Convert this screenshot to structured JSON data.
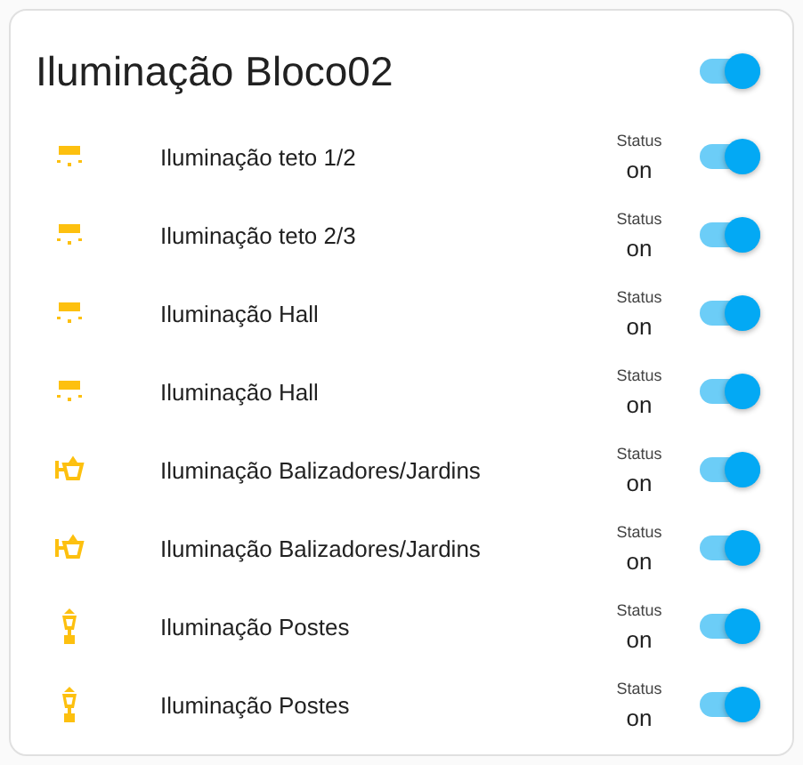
{
  "card": {
    "title": "Iluminação Bloco02",
    "master_on": true
  },
  "entities": [
    {
      "kind": "ceiling",
      "name": "Iluminação teto 1/2",
      "status_label": "Status",
      "status": "on",
      "on": true
    },
    {
      "kind": "ceiling",
      "name": "Iluminação teto 2/3",
      "status_label": "Status",
      "status": "on",
      "on": true
    },
    {
      "kind": "ceiling",
      "name": "Iluminação Hall",
      "status_label": "Status",
      "status": "on",
      "on": true
    },
    {
      "kind": "ceiling",
      "name": "Iluminação Hall",
      "status_label": "Status",
      "status": "on",
      "on": true
    },
    {
      "kind": "wall",
      "name": "Iluminação Balizadores/Jardins",
      "status_label": "Status",
      "status": "on",
      "on": true
    },
    {
      "kind": "wall",
      "name": "Iluminação Balizadores/Jardins",
      "status_label": "Status",
      "status": "on",
      "on": true
    },
    {
      "kind": "post",
      "name": "Iluminação Postes",
      "status_label": "Status",
      "status": "on",
      "on": true
    },
    {
      "kind": "post",
      "name": "Iluminação Postes",
      "status_label": "Status",
      "status": "on",
      "on": true
    }
  ]
}
